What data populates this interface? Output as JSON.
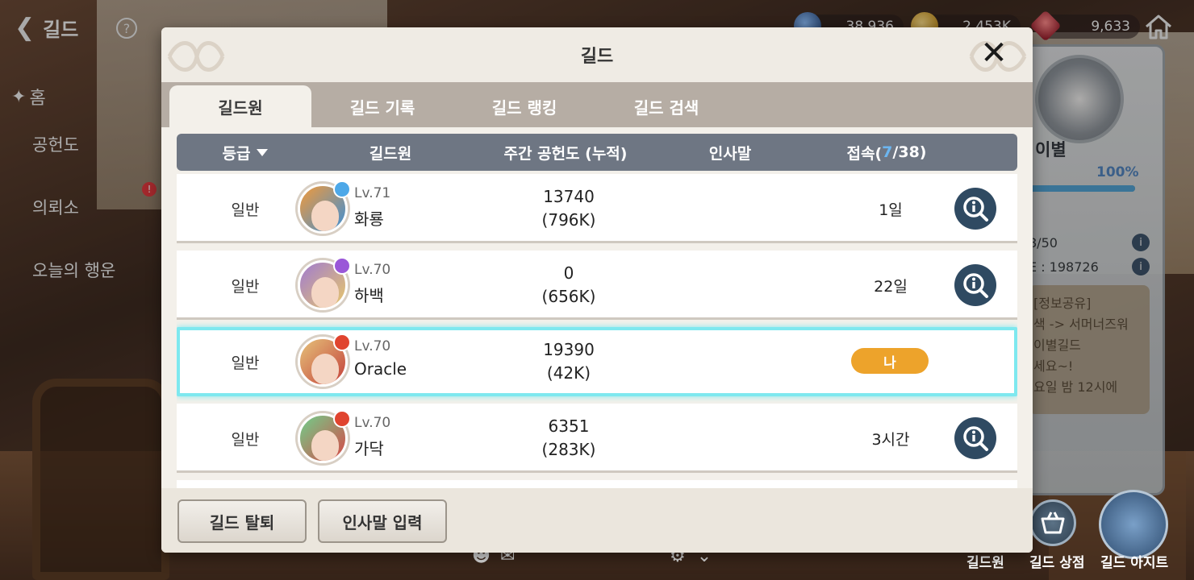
{
  "hud": {
    "back_label": "길드",
    "currencies": [
      {
        "value": "38,936",
        "icon": "orb-icon"
      },
      {
        "value": "2,453K",
        "icon": "gold-coin-icon"
      },
      {
        "value": "9,633",
        "icon": "ruby-icon"
      }
    ]
  },
  "side_menu": {
    "home": "홈",
    "items": [
      "공헌도",
      "의뢰소",
      "오늘의 행운"
    ],
    "badge": "!"
  },
  "right_panel": {
    "guild_name": "이별",
    "progress_label": "100%",
    "progress": 1.0,
    "stat1": "8/50",
    "stat2": "E : 198726",
    "notice_lines": [
      "[정보공유]",
      "색 -> 서머너즈워",
      "이별길드",
      "세요~!",
      "요일 밤 12시에"
    ]
  },
  "bottom_buttons": {
    "members": "길드원",
    "shop": "길드 상점",
    "hideout": "길드 아지트"
  },
  "modal": {
    "title": "길드",
    "tabs": [
      "길드원",
      "길드 기록",
      "길드 랭킹",
      "길드 검색"
    ],
    "columns": {
      "grade": "등급",
      "member": "길드원",
      "contribution": "주간 공헌도 (누적)",
      "greeting": "인사말",
      "access_prefix": "접속(",
      "access_online": "7",
      "access_suffix": "/38)"
    },
    "rows": [
      {
        "grade": "일반",
        "level": "Lv.71",
        "name": "화룡",
        "weekly": "13740",
        "total": "(796K)",
        "access": "1일",
        "is_me": false
      },
      {
        "grade": "일반",
        "level": "Lv.70",
        "name": "하백",
        "weekly": "0",
        "total": "(656K)",
        "access": "22일",
        "is_me": false
      },
      {
        "grade": "일반",
        "level": "Lv.70",
        "name": "Oracle",
        "weekly": "19390",
        "total": "(42K)",
        "access": "나",
        "is_me": true
      },
      {
        "grade": "일반",
        "level": "Lv.70",
        "name": "가닥",
        "weekly": "6351",
        "total": "(283K)",
        "access": "3시간",
        "is_me": false
      }
    ],
    "buttons": {
      "leave": "길드 탈퇴",
      "greeting_input": "인사말 입력"
    }
  }
}
